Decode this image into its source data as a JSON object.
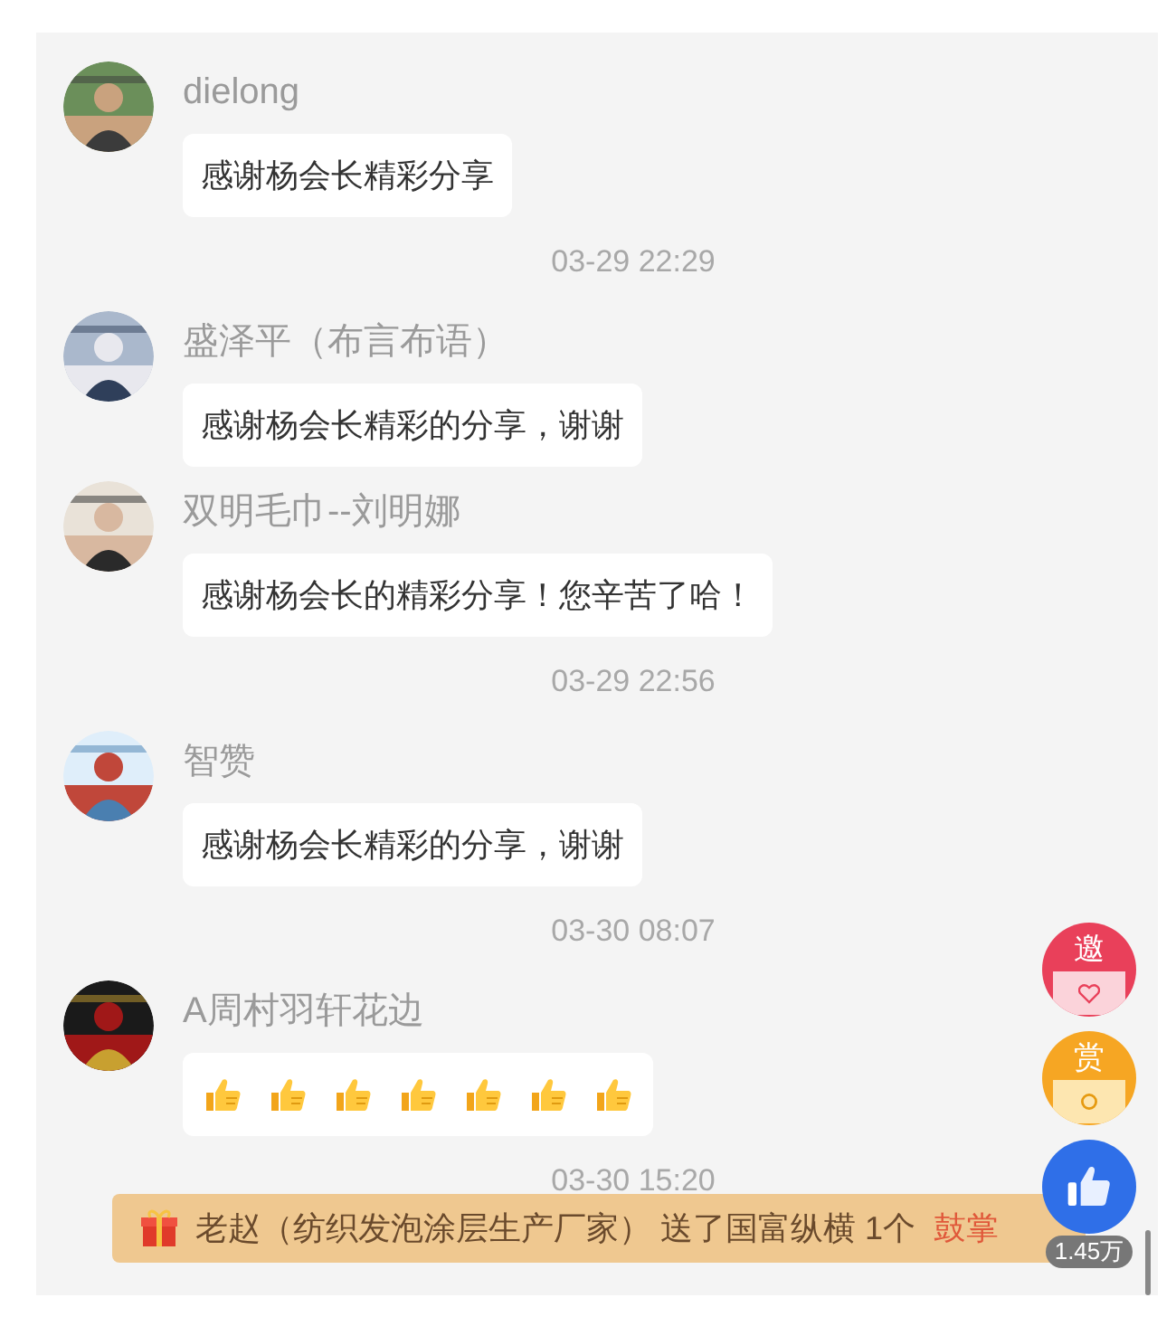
{
  "feed": [
    {
      "kind": "message",
      "name": "dielong",
      "text": "感谢杨会长精彩分享"
    },
    {
      "kind": "time",
      "text": "03-29 22:29"
    },
    {
      "kind": "message",
      "name": "盛泽平（布言布语）",
      "text": "感谢杨会长精彩的分享，谢谢"
    },
    {
      "kind": "message",
      "name": "双明毛巾--刘明娜",
      "text": "感谢杨会长的精彩分享！您辛苦了哈！"
    },
    {
      "kind": "time",
      "text": "03-29 22:56"
    },
    {
      "kind": "message",
      "name": "智赞",
      "text": "感谢杨会长精彩的分享，谢谢"
    },
    {
      "kind": "time",
      "text": "03-30 08:07"
    },
    {
      "kind": "message",
      "name": "A周村羽轩花边",
      "reactions": [
        {
          "kind": "thumbs_up"
        },
        {
          "kind": "thumbs_up"
        },
        {
          "kind": "thumbs_up"
        },
        {
          "kind": "thumbs_up"
        },
        {
          "kind": "thumbs_up"
        },
        {
          "kind": "thumbs_up"
        },
        {
          "kind": "thumbs_up"
        }
      ]
    },
    {
      "kind": "time",
      "text": "03-30 15:20"
    }
  ],
  "gift_banner": {
    "text": "老赵（纺织发泡涂层生产厂家） 送了国富纵横 1个",
    "action": "鼓掌"
  },
  "side_buttons": [
    {
      "kind": "invite",
      "label": "邀"
    },
    {
      "kind": "reward",
      "label": "赏"
    },
    {
      "kind": "like",
      "count": "1.45万"
    }
  ]
}
